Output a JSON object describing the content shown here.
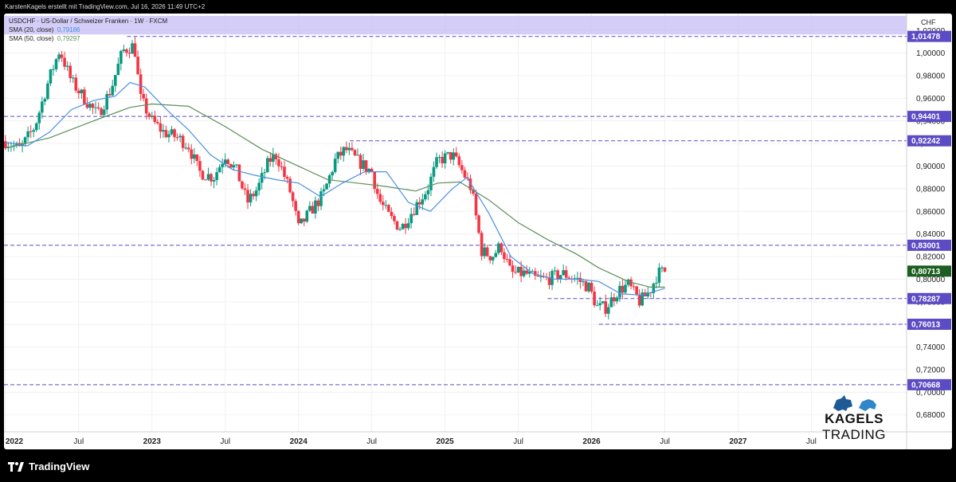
{
  "header": {
    "attribution": "KarstenKagels erstellt mit TradingView.com, Jul 16, 2026 11:49 UTC+2"
  },
  "legend": {
    "symbol": "USDCHF · US-Dollar / Schweizer Franken · 1W · FXCM",
    "sma20_label": "SMA (20, close)",
    "sma20_value": "0,79186",
    "sma50_label": "SMA (50, close)",
    "sma50_value": "0,79297"
  },
  "footer": {
    "brand": "TradingView"
  },
  "watermark": {
    "text_bold": "KAGELS",
    "text_light": " TRADING"
  },
  "colors": {
    "up": "#089981",
    "down": "#f23645",
    "sma20": "#4a90e2",
    "sma50": "#5a8f5a",
    "level": "#5b4bc4",
    "current": "#1b5e20",
    "zone": "#c9c1f5"
  },
  "chart_data": {
    "type": "candlestick",
    "currency_label": "CHF",
    "y_axis_ticks": [
      "1,02000",
      "1,00000",
      "0,98000",
      "0,96000",
      "0,94000",
      "0,92000",
      "0,90000",
      "0,88000",
      "0,86000",
      "0,84000",
      "0,82000",
      "0,80000",
      "0,78000",
      "0,76000",
      "0,74000",
      "0,72000",
      "0,70000",
      "0,68000"
    ],
    "ylim": [
      0.665,
      1.035
    ],
    "x_axis_ticks": [
      {
        "label": "2022",
        "t": 2022.0,
        "bold": true
      },
      {
        "label": "Jul",
        "t": 2022.5,
        "bold": false
      },
      {
        "label": "2023",
        "t": 2023.0,
        "bold": true
      },
      {
        "label": "Jul",
        "t": 2023.5,
        "bold": false
      },
      {
        "label": "2024",
        "t": 2024.0,
        "bold": true
      },
      {
        "label": "Jul",
        "t": 2024.5,
        "bold": false
      },
      {
        "label": "2025",
        "t": 2025.0,
        "bold": true
      },
      {
        "label": "Jul",
        "t": 2025.5,
        "bold": false
      },
      {
        "label": "2026",
        "t": 2026.0,
        "bold": true
      },
      {
        "label": "Jul",
        "t": 2026.5,
        "bold": false
      },
      {
        "label": "2027",
        "t": 2027.0,
        "bold": true
      },
      {
        "label": "Jul",
        "t": 2027.5,
        "bold": false
      }
    ],
    "xlim": [
      2021.99,
      2028.15
    ],
    "horizontal_levels": [
      {
        "label": "1,01478",
        "value": 1.01478,
        "from": 2022.83
      },
      {
        "label": "0,94401",
        "value": 0.94401,
        "from": 2021.99
      },
      {
        "label": "0,92242",
        "value": 0.92242,
        "from": 2024.35
      },
      {
        "label": "0,83001",
        "value": 0.83001,
        "from": 2021.99
      },
      {
        "label": "0,78287",
        "value": 0.78287,
        "from": 2025.7
      },
      {
        "label": "0,76013",
        "value": 0.76013,
        "from": 2026.05
      },
      {
        "label": "0,70668",
        "value": 0.70668,
        "from": 2021.99
      }
    ],
    "resistance_zone": [
      1.0165,
      1.033
    ],
    "current_price": "0,80713",
    "current_value": 0.80713,
    "price_path": [
      [
        2022.0,
        0.922
      ],
      [
        2022.1,
        0.915
      ],
      [
        2022.2,
        0.935
      ],
      [
        2022.3,
        0.978
      ],
      [
        2022.37,
        1.003
      ],
      [
        2022.45,
        0.975
      ],
      [
        2022.55,
        0.958
      ],
      [
        2022.63,
        0.945
      ],
      [
        2022.72,
        0.968
      ],
      [
        2022.8,
        1.002
      ],
      [
        2022.88,
        1.007
      ],
      [
        2022.92,
        0.96
      ],
      [
        2023.0,
        0.94
      ],
      [
        2023.08,
        0.93
      ],
      [
        2023.18,
        0.925
      ],
      [
        2023.25,
        0.918
      ],
      [
        2023.32,
        0.895
      ],
      [
        2023.42,
        0.89
      ],
      [
        2023.5,
        0.91
      ],
      [
        2023.58,
        0.895
      ],
      [
        2023.65,
        0.868
      ],
      [
        2023.72,
        0.88
      ],
      [
        2023.8,
        0.905
      ],
      [
        2023.85,
        0.91
      ],
      [
        2023.95,
        0.875
      ],
      [
        2024.0,
        0.845
      ],
      [
        2024.08,
        0.86
      ],
      [
        2024.17,
        0.875
      ],
      [
        2024.25,
        0.905
      ],
      [
        2024.32,
        0.915
      ],
      [
        2024.4,
        0.905
      ],
      [
        2024.5,
        0.895
      ],
      [
        2024.55,
        0.87
      ],
      [
        2024.62,
        0.855
      ],
      [
        2024.7,
        0.845
      ],
      [
        2024.8,
        0.865
      ],
      [
        2024.88,
        0.88
      ],
      [
        2024.95,
        0.905
      ],
      [
        2025.05,
        0.91
      ],
      [
        2025.12,
        0.895
      ],
      [
        2025.18,
        0.88
      ],
      [
        2025.25,
        0.825
      ],
      [
        2025.32,
        0.82
      ],
      [
        2025.38,
        0.83
      ],
      [
        2025.45,
        0.805
      ],
      [
        2025.55,
        0.805
      ],
      [
        2025.62,
        0.8
      ],
      [
        2025.7,
        0.8
      ],
      [
        2025.8,
        0.805
      ],
      [
        2025.9,
        0.8
      ],
      [
        2025.98,
        0.793
      ],
      [
        2026.04,
        0.775
      ],
      [
        2026.1,
        0.775
      ],
      [
        2026.18,
        0.79
      ],
      [
        2026.25,
        0.795
      ],
      [
        2026.33,
        0.78
      ],
      [
        2026.4,
        0.79
      ],
      [
        2026.45,
        0.805
      ],
      [
        2026.5,
        0.8071
      ]
    ],
    "sma20_path": [
      [
        2022.0,
        0.921
      ],
      [
        2022.15,
        0.918
      ],
      [
        2022.3,
        0.93
      ],
      [
        2022.45,
        0.95
      ],
      [
        2022.6,
        0.958
      ],
      [
        2022.75,
        0.962
      ],
      [
        2022.85,
        0.974
      ],
      [
        2022.95,
        0.97
      ],
      [
        2023.1,
        0.95
      ],
      [
        2023.25,
        0.932
      ],
      [
        2023.4,
        0.91
      ],
      [
        2023.55,
        0.897
      ],
      [
        2023.7,
        0.892
      ],
      [
        2023.85,
        0.888
      ],
      [
        2024.0,
        0.885
      ],
      [
        2024.15,
        0.873
      ],
      [
        2024.3,
        0.885
      ],
      [
        2024.45,
        0.895
      ],
      [
        2024.6,
        0.895
      ],
      [
        2024.75,
        0.868
      ],
      [
        2024.9,
        0.86
      ],
      [
        2025.05,
        0.88
      ],
      [
        2025.15,
        0.89
      ],
      [
        2025.3,
        0.858
      ],
      [
        2025.45,
        0.82
      ],
      [
        2025.6,
        0.805
      ],
      [
        2025.75,
        0.8
      ],
      [
        2025.9,
        0.8
      ],
      [
        2026.05,
        0.798
      ],
      [
        2026.2,
        0.787
      ],
      [
        2026.35,
        0.786
      ],
      [
        2026.5,
        0.792
      ]
    ],
    "sma50_path": [
      [
        2022.0,
        0.916
      ],
      [
        2022.3,
        0.925
      ],
      [
        2022.6,
        0.94
      ],
      [
        2022.85,
        0.952
      ],
      [
        2023.0,
        0.955
      ],
      [
        2023.25,
        0.953
      ],
      [
        2023.5,
        0.935
      ],
      [
        2023.75,
        0.915
      ],
      [
        2024.0,
        0.9
      ],
      [
        2024.2,
        0.888
      ],
      [
        2024.4,
        0.885
      ],
      [
        2024.6,
        0.882
      ],
      [
        2024.8,
        0.878
      ],
      [
        2024.95,
        0.885
      ],
      [
        2025.1,
        0.886
      ],
      [
        2025.3,
        0.87
      ],
      [
        2025.5,
        0.85
      ],
      [
        2025.7,
        0.835
      ],
      [
        2025.9,
        0.822
      ],
      [
        2026.05,
        0.81
      ],
      [
        2026.25,
        0.798
      ],
      [
        2026.4,
        0.793
      ],
      [
        2026.5,
        0.793
      ]
    ]
  }
}
